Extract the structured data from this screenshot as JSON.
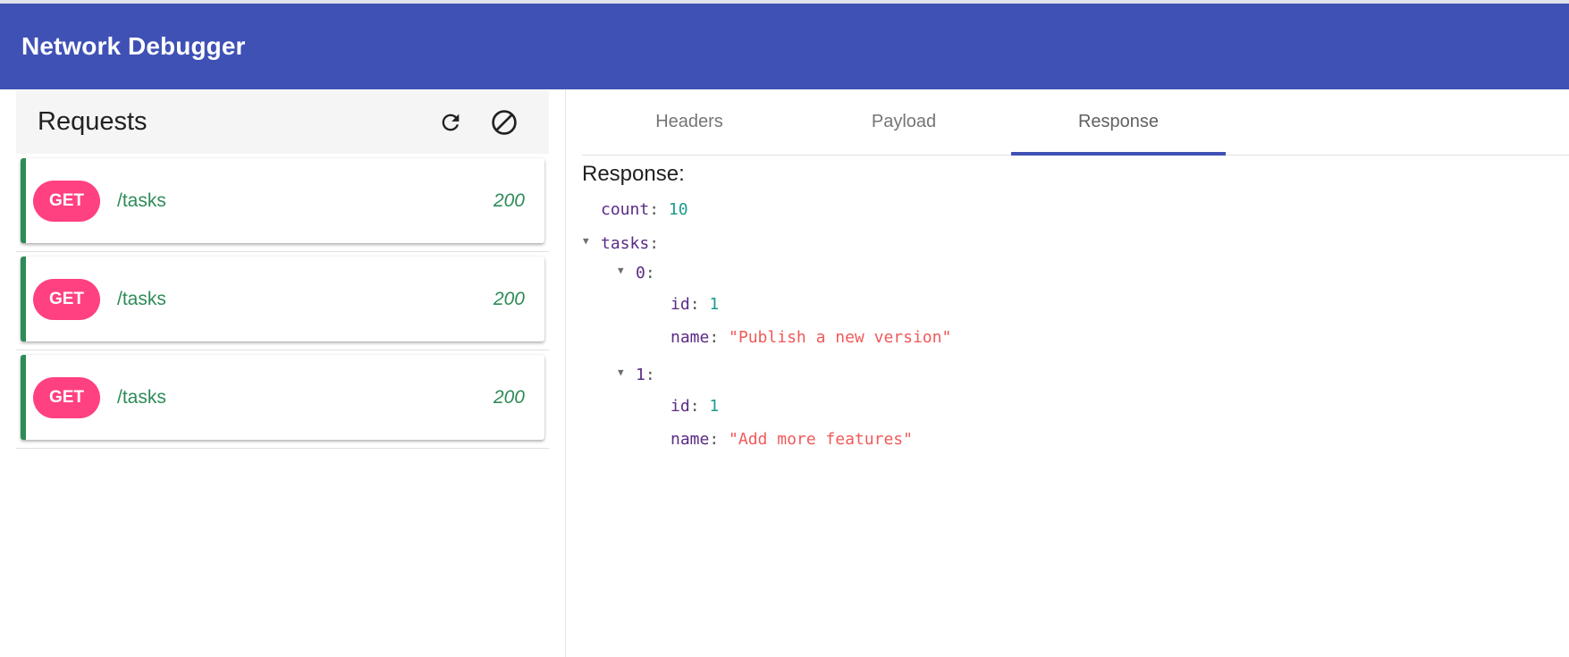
{
  "app": {
    "title": "Network Debugger"
  },
  "requests": {
    "title": "Requests",
    "actions": {
      "refresh_icon": "refresh-icon",
      "clear_icon": "block-icon"
    },
    "items": [
      {
        "method": "GET",
        "path": "/tasks",
        "status": "200"
      },
      {
        "method": "GET",
        "path": "/tasks",
        "status": "200"
      },
      {
        "method": "GET",
        "path": "/tasks",
        "status": "200"
      }
    ]
  },
  "tabs": [
    {
      "label": "Headers",
      "active": false
    },
    {
      "label": "Payload",
      "active": false
    },
    {
      "label": "Response",
      "active": true
    }
  ],
  "response": {
    "label": "Response:",
    "count_key": "count",
    "count_value": "10",
    "tasks_key": "tasks",
    "tasks": [
      {
        "index": "0",
        "id_key": "id",
        "id_value": "1",
        "name_key": "name",
        "name_value": "\"Publish a new version\""
      },
      {
        "index": "1",
        "id_key": "id",
        "id_value": "1",
        "name_key": "name",
        "name_value": "\"Add more features\""
      }
    ]
  },
  "colors": {
    "app_bar": "#3f51b5",
    "method_badge": "#ff4081",
    "success": "#2e8b57",
    "tab_indicator": "#3f51b5"
  }
}
